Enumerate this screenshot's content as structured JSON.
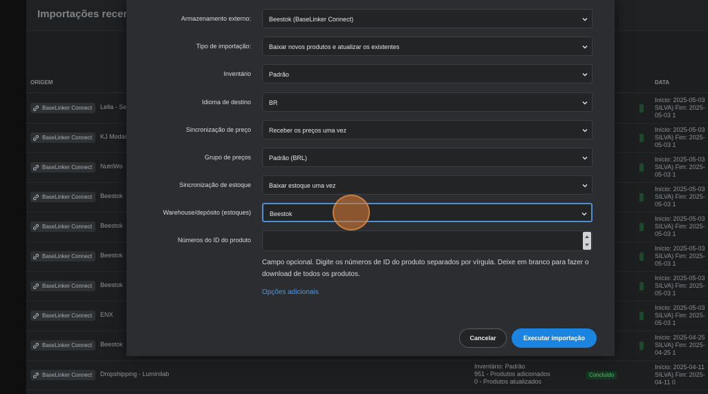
{
  "background": {
    "title": "Importações recentes",
    "col_origem": "ORIGEM",
    "col_data": "DATA",
    "rows": [
      {
        "source": "BaseLinker Connect",
        "name": "Lella - Se",
        "date": "Início: 2025-05-03 SILVA) Fim: 2025-05-03 1"
      },
      {
        "source": "BaseLinker Connect",
        "name": "KJ Modas",
        "date": "Início: 2025-05-03 SILVA) Fim: 2025-05-03 1"
      },
      {
        "source": "BaseLinker Connect",
        "name": "NutriWo",
        "date": "Início: 2025-05-03 SILVA) Fim: 2025-05-03 1"
      },
      {
        "source": "BaseLinker Connect",
        "name": "Beestok",
        "date": "Início: 2025-05-03 SILVA) Fim: 2025-05-03 1"
      },
      {
        "source": "BaseLinker Connect",
        "name": "Beestok",
        "date": "Início: 2025-05-03 SILVA) Fim: 2025-05-03 1"
      },
      {
        "source": "BaseLinker Connect",
        "name": "Beestok",
        "date": "Início: 2025-05-03 SILVA) Fim: 2025-05-03 1"
      },
      {
        "source": "BaseLinker Connect",
        "name": "Beestok",
        "date": "Início: 2025-05-03 SILVA) Fim: 2025-05-03 1"
      },
      {
        "source": "BaseLinker Connect",
        "name": "ENX",
        "date": "Início: 2025-05-03 SILVA) Fim: 2025-05-03 1"
      },
      {
        "source": "BaseLinker Connect",
        "name": "Beestok",
        "date": "Início: 2025-04-25 SILVA) Fim: 2025-04-25 1"
      },
      {
        "source": "BaseLinker Connect",
        "name": "Dropshipping - Luminilab",
        "date": "Início: 2025-04-11 SILVA) Fim: 2025-04-11 0"
      }
    ],
    "last_row_info": [
      "Inventário: Padrão",
      "951 - Produtos adicionados",
      "0 - Produtos atualizados"
    ],
    "status_label": "Concluído"
  },
  "form": {
    "fields": [
      {
        "label": "Armazenamento externo:",
        "value": "Beestok (BaseLinker Connect)"
      },
      {
        "label": "Tipo de importação:",
        "value": "Baixar novos produtos e atualizar os existentes"
      },
      {
        "label": "Inventário",
        "value": "Padrão"
      },
      {
        "label": "Idioma de destino",
        "value": "BR"
      },
      {
        "label": "Sincronização de preço",
        "value": "Receber os preços uma vez"
      },
      {
        "label": "Grupo de preços",
        "value": "Padrão (BRL)"
      },
      {
        "label": "Sincronização de estoque",
        "value": "Baixar estoque uma vez"
      },
      {
        "label": "Warehouse/depósito (estoques)",
        "value": "Beestok"
      }
    ],
    "id_label": "Números do ID do produto",
    "id_value": "",
    "help_text": "Campo opcional. Digite os números de ID do produto separados por vírgula. Deixe em branco para fazer o download de todos os produtos.",
    "additional_link": "Opções adicionais",
    "cancel_label": "Cancelar",
    "run_label": "Executar importação"
  },
  "colors": {
    "accent": "#1a84e0",
    "link": "#4a9ae8",
    "status": "#58c27a"
  }
}
